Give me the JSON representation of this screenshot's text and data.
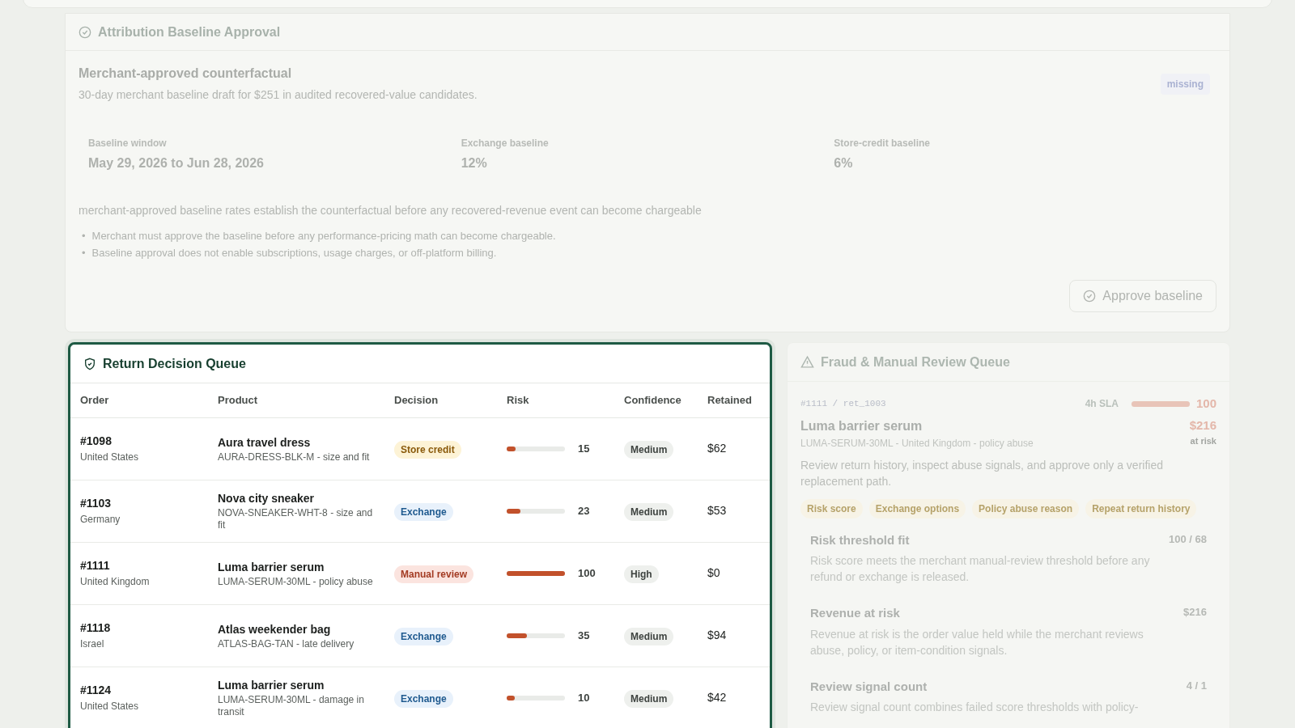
{
  "baseline": {
    "title": "Attribution Baseline Approval",
    "subtitle": "Merchant-approved counterfactual",
    "description": "30-day merchant baseline draft for $251 in audited recovered-value candidates.",
    "status": "missing",
    "stats": [
      {
        "label": "Baseline window",
        "value": "May 29, 2026 to Jun 28, 2026"
      },
      {
        "label": "Exchange baseline",
        "value": "12%"
      },
      {
        "label": "Store-credit baseline",
        "value": "6%"
      }
    ],
    "note": "merchant-approved baseline rates establish the counterfactual before any recovered-revenue event can become chargeable",
    "bullets": [
      {
        "marker": "•",
        "text": "Merchant must approve the baseline before any performance-pricing math can become chargeable."
      },
      {
        "marker": "•",
        "text": "Baseline approval does not enable subscriptions, usage charges, or off-platform billing."
      }
    ],
    "button": "Approve baseline"
  },
  "queue": {
    "title": "Return Decision Queue",
    "columns": [
      "Order",
      "Product",
      "Decision",
      "Risk",
      "Confidence",
      "Retained"
    ],
    "rows": [
      {
        "order": "#1098",
        "country": "United States",
        "product": "Aura travel dress",
        "detail": "AURA-DRESS-BLK-M - size and fit",
        "decision": "Store credit",
        "kind": "credit",
        "level": 0.15,
        "risk": "15",
        "confidence": "Medium",
        "retained": "$62"
      },
      {
        "order": "#1103",
        "country": "Germany",
        "product": "Nova city sneaker",
        "detail": "NOVA-SNEAKER-WHT-8 - size and fit",
        "decision": "Exchange",
        "kind": "exchange",
        "level": 0.23,
        "risk": "23",
        "confidence": "Medium",
        "retained": "$53"
      },
      {
        "order": "#1111",
        "country": "United Kingdom",
        "product": "Luma barrier serum",
        "detail": "LUMA-SERUM-30ML - policy abuse",
        "decision": "Manual review",
        "kind": "review",
        "level": 1,
        "risk": "100",
        "confidence": "High",
        "retained": "$0"
      },
      {
        "order": "#1118",
        "country": "Israel",
        "product": "Atlas weekender bag",
        "detail": "ATLAS-BAG-TAN - late delivery",
        "decision": "Exchange",
        "kind": "exchange",
        "level": 0.35,
        "risk": "35",
        "confidence": "Medium",
        "retained": "$94"
      },
      {
        "order": "#1124",
        "country": "United States",
        "product": "Luma barrier serum",
        "detail": "LUMA-SERUM-30ML - damage in transit",
        "decision": "Exchange",
        "kind": "exchange",
        "level": 0.1,
        "risk": "10",
        "confidence": "Medium",
        "retained": "$42"
      }
    ]
  },
  "fraud": {
    "title": "Fraud & Manual Review Queue",
    "ref": "#1111 / ret_1003",
    "sla": "4h SLA",
    "level": 1,
    "score": "100",
    "product": "Luma barrier serum",
    "amount": "$216",
    "amount_label": "at risk",
    "detail": "LUMA-SERUM-30ML - United Kingdom - policy abuse",
    "instruction": "Review return history, inspect abuse signals, and approve only a verified replacement path.",
    "tags": [
      "Risk score",
      "Exchange options",
      "Policy abuse reason",
      "Repeat return history"
    ],
    "signals": [
      {
        "title": "Risk threshold fit",
        "value": "100 / 68",
        "text": "Risk score meets the merchant manual-review threshold before any refund or exchange is released."
      },
      {
        "title": "Revenue at risk",
        "value": "$216",
        "text": "Revenue at risk is the order value held while the merchant reviews abuse, policy, or item-condition signals."
      },
      {
        "title": "Review signal count",
        "value": "4 / 1",
        "text": "Review signal count combines failed score thresholds with policy-"
      }
    ]
  }
}
